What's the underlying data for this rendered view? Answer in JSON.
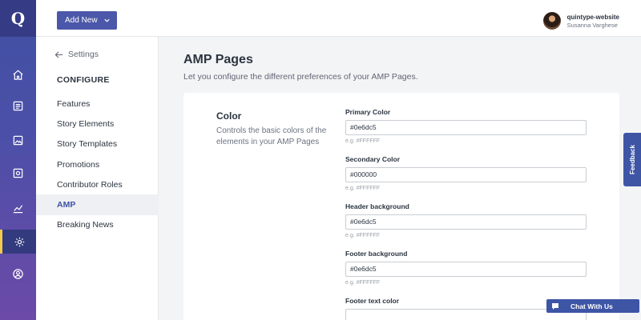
{
  "rail": {
    "logo_glyph": "Q",
    "items": [
      {
        "icon": "home-icon"
      },
      {
        "icon": "stories-icon"
      },
      {
        "icon": "image-gallery-icon"
      },
      {
        "icon": "media-icon"
      },
      {
        "icon": "analytics-icon"
      },
      {
        "icon": "settings-icon",
        "active": true
      },
      {
        "icon": "user-icon"
      }
    ],
    "active_color": "#f2c94c"
  },
  "topbar": {
    "add_new_label": "Add New",
    "profile": {
      "name": "quintype-website",
      "user": "Susanna Varghese"
    }
  },
  "sidebar": {
    "back_label": "Settings",
    "section_heading": "CONFIGURE",
    "items": [
      {
        "label": "Features"
      },
      {
        "label": "Story Elements"
      },
      {
        "label": "Story Templates"
      },
      {
        "label": "Promotions"
      },
      {
        "label": "Contributor Roles"
      },
      {
        "label": "AMP",
        "active": true
      },
      {
        "label": "Breaking News"
      }
    ]
  },
  "main": {
    "title": "AMP Pages",
    "subtitle": "Let you configure the different preferences of your AMP Pages.",
    "section": {
      "title": "Color",
      "description": "Controls the basic colors of the elements in your AMP Pages"
    },
    "fields": [
      {
        "label": "Primary Color",
        "value": "#0e6dc5",
        "hint": "e.g. #FFFFFF"
      },
      {
        "label": "Secondary Color",
        "value": "#000000",
        "hint": "e.g. #FFFFFF"
      },
      {
        "label": "Header background",
        "value": "#0e6dc5",
        "hint": "e.g. #FFFFFF"
      },
      {
        "label": "Footer background",
        "value": "#0e6dc5",
        "hint": "e.g. #FFFFFF"
      },
      {
        "label": "Footer text color",
        "value": "",
        "hint": ""
      }
    ]
  },
  "widgets": {
    "feedback_label": "Feedback",
    "chat_label": "Chat With Us"
  },
  "colors": {
    "brand": "#3f51a3",
    "button": "#4b57a8",
    "widget": "#3e55a6"
  }
}
